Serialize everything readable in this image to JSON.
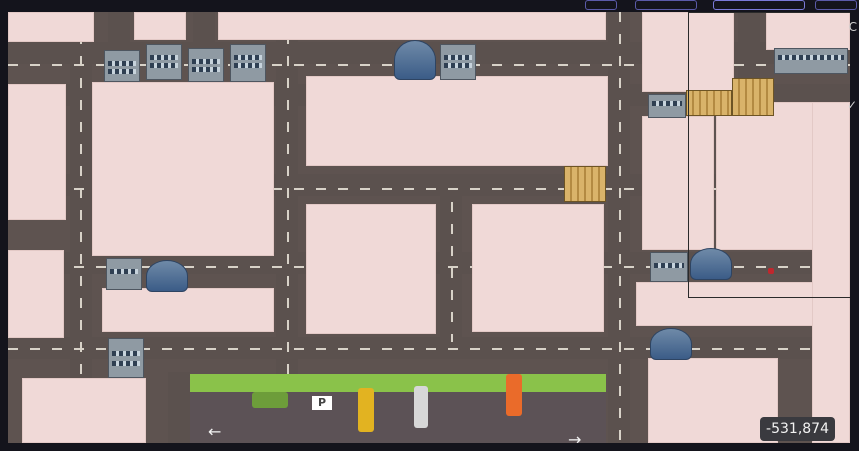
{
  "game": {
    "coordinates_readout": "-531,874",
    "side_glyphs": [
      "C",
      "✓"
    ]
  },
  "colors": {
    "road": "#5b514e",
    "block": "#f0d9d7",
    "park": "#8ac24a",
    "parking_lot": "#5c5256"
  },
  "icons": {
    "parking": "P",
    "arrow_left": "←",
    "arrow_right": "→"
  }
}
